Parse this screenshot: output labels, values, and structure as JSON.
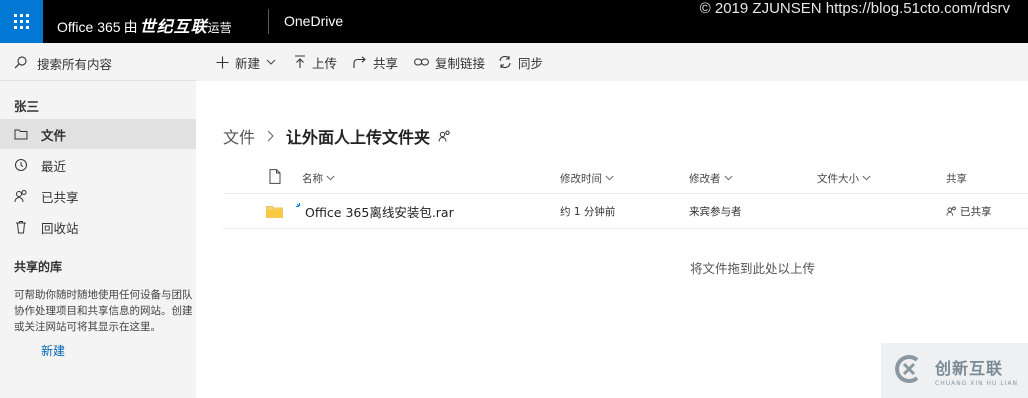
{
  "topbar": {
    "brand_prefix": "Office 365",
    "brand_by": "由",
    "brand_partner": "世纪互联",
    "brand_suffix": "运营",
    "app_name": "OneDrive",
    "watermark": "© 2019 ZJUNSEN https://blog.51cto.com/rdsrv",
    "accent": "#0078d4"
  },
  "leftnav": {
    "search_label": "搜索所有内容",
    "user_name": "张三",
    "items": [
      {
        "label": "文件",
        "icon": "folder-icon",
        "active": true
      },
      {
        "label": "最近",
        "icon": "history-icon",
        "active": false
      },
      {
        "label": "已共享",
        "icon": "people-icon",
        "active": false
      },
      {
        "label": "回收站",
        "icon": "recycle-bin-icon",
        "active": false
      }
    ],
    "shared_libraries_title": "共享的库",
    "shared_libraries_desc": "可帮助你随时随地使用任何设备与团队协作处理项目和共享信息的网站。创建或关注网站可将其显示在这里。",
    "new_link": "新建"
  },
  "commandbar": {
    "new": "新建",
    "upload": "上传",
    "share": "共享",
    "copy_link": "复制链接",
    "sync": "同步"
  },
  "breadcrumb": {
    "root": "文件",
    "current": "让外面人上传文件夹"
  },
  "list": {
    "columns": {
      "name": "名称",
      "modified": "修改时间",
      "modified_by": "修改者",
      "size": "文件大小",
      "sharing": "共享"
    },
    "rows": [
      {
        "name": "Office 365离线安装包.rar",
        "modified": "约 1 分钟前",
        "modified_by": "来宾参与者",
        "size": "",
        "sharing": "已共享"
      }
    ],
    "drop_hint": "将文件拖到此处以上传"
  },
  "logo": {
    "name": "创新互联",
    "pinyin": "CHUANG XIN HU LIAN"
  }
}
